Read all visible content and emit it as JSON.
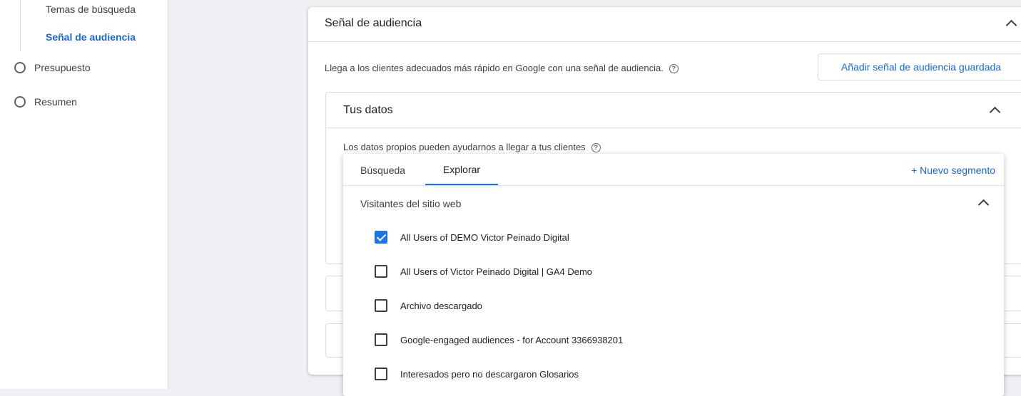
{
  "sidebar": {
    "sub_items": [
      "Temas de búsqueda",
      "Señal de audiencia"
    ],
    "steps": [
      "Presupuesto",
      "Resumen"
    ]
  },
  "card": {
    "title": "Señal de audiencia",
    "description": "Llega a los clientes adecuados más rápido en Google con una señal de audiencia.",
    "add_saved_button": "Añadir señal de audiencia guardada"
  },
  "your_data": {
    "title": "Tus datos",
    "description": "Los datos propios pueden ayudarnos a llegar a tus clientes"
  },
  "popup": {
    "tabs": [
      "Búsqueda",
      "Explorar"
    ],
    "active_tab": "Explorar",
    "new_segment": "+ Nuevo segmento",
    "section": "Visitantes del sitio web",
    "items": [
      {
        "label": "All Users of DEMO Victor Peinado Digital",
        "checked": true
      },
      {
        "label": "All Users of Victor Peinado Digital | GA4 Demo",
        "checked": false
      },
      {
        "label": "Archivo descargado",
        "checked": false
      },
      {
        "label": "Google-engaged audiences - for Account 3366938201",
        "checked": false
      },
      {
        "label": "Interesados pero no descargaron Glosarios",
        "checked": false
      }
    ]
  },
  "colors": {
    "accent": "#1a73e8",
    "link": "#1967d2"
  }
}
